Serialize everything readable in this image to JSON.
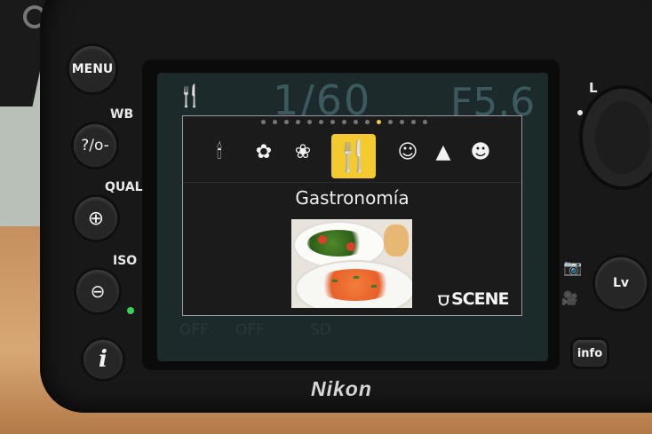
{
  "scene_menu": {
    "page_dots_count": 15,
    "active_dot_index": 10,
    "selected_title": "Gastronomía",
    "badge": "SCENE",
    "icons": [
      {
        "name": "candle-icon",
        "glyph": "🕯"
      },
      {
        "name": "blossom-icon",
        "glyph": "✿"
      },
      {
        "name": "autumn-colors-icon",
        "glyph": "❀"
      },
      {
        "name": "food-icon",
        "glyph": "🍴",
        "selected": true
      },
      {
        "name": "portrait-icon",
        "glyph": "☺"
      },
      {
        "name": "landscape-icon",
        "glyph": "▲"
      },
      {
        "name": "pet-portrait-icon",
        "glyph": "☻"
      }
    ]
  },
  "lcd_background": {
    "shutter": "1/60",
    "aperture": "F5.6",
    "bottom_1": "OFF",
    "bottom_2": "OFF",
    "bottom_3": "SD"
  },
  "buttons": {
    "menu": "MENU",
    "help": "?/o-",
    "zoom_in": "⊕",
    "zoom_out": "⊖",
    "info_i": "i",
    "lv": "Lv",
    "info": "info"
  },
  "labels": {
    "wb": "WB",
    "qual": "QUAL",
    "iso": "ISO",
    "l": "L"
  },
  "brand": "Nikon"
}
